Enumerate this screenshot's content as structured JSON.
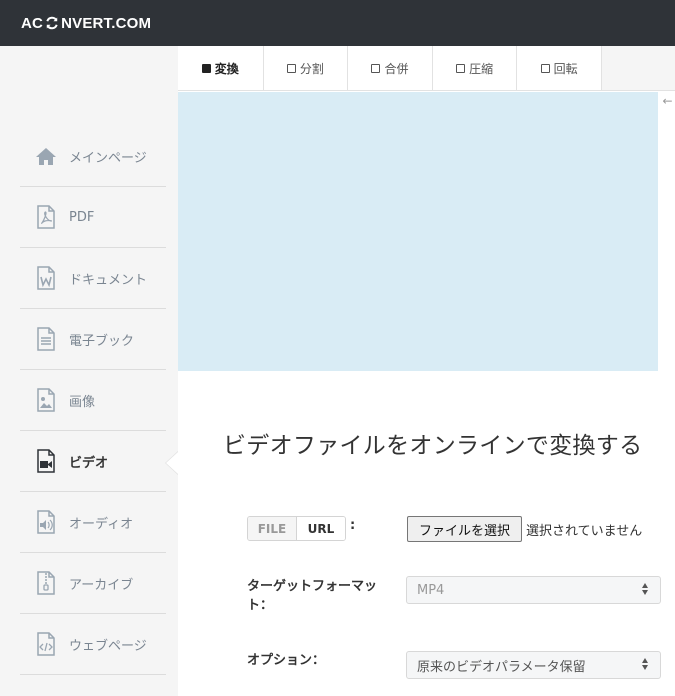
{
  "header": {
    "logo_left": "AC",
    "logo_icon": "convert-refresh-icon",
    "logo_right": "NVERT.COM"
  },
  "sidebar": {
    "items": [
      {
        "label": "メインページ",
        "icon": "home-icon"
      },
      {
        "label": "PDF",
        "icon": "pdf-file-icon"
      },
      {
        "label": "ドキュメント",
        "icon": "word-document-icon"
      },
      {
        "label": "電子ブック",
        "icon": "ebook-file-icon"
      },
      {
        "label": "画像",
        "icon": "image-file-icon"
      },
      {
        "label": "ビデオ",
        "icon": "video-camera-icon",
        "active": true
      },
      {
        "label": "オーディオ",
        "icon": "audio-file-icon"
      },
      {
        "label": "アーカイブ",
        "icon": "archive-file-icon"
      },
      {
        "label": "ウェブページ",
        "icon": "code-file-icon"
      }
    ]
  },
  "tabs": [
    {
      "label": "変換",
      "active": true
    },
    {
      "label": "分割"
    },
    {
      "label": "合併"
    },
    {
      "label": "圧縮"
    },
    {
      "label": "回転"
    }
  ],
  "main": {
    "heading": "ビデオファイルをオンラインで変換する",
    "source_toggle": {
      "file": "FILE",
      "url": "URL",
      "colon": ":"
    },
    "file_button": "ファイルを選択",
    "file_status": "選択されていません",
    "target_format": {
      "label_line1": "ターゲットフォーマッ",
      "label_line2": "ト：",
      "value": "MP4"
    },
    "options": {
      "label": "オプション：",
      "value": "原来のビデオパラメータ保留"
    }
  },
  "colors": {
    "topbar": "#2f3338",
    "ad_area": "#d9ecf5",
    "sidebar_bg": "#f5f5f5",
    "icon_gray": "#9aa6b2"
  }
}
